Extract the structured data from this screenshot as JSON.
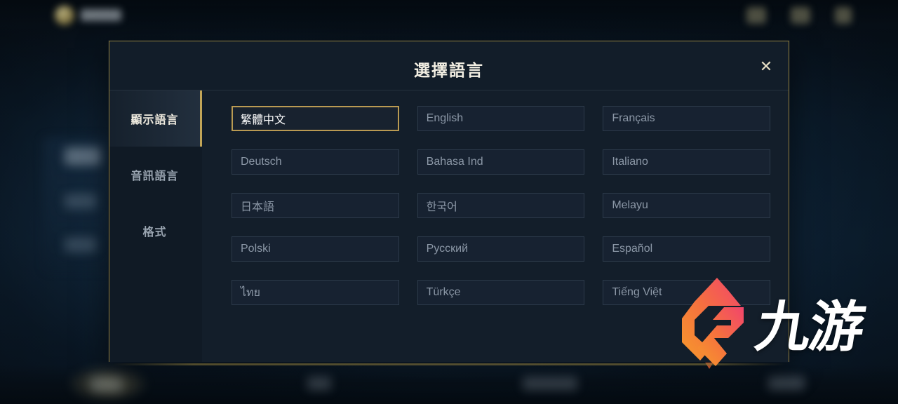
{
  "modal": {
    "title": "選擇語言",
    "close_label": "✕",
    "close_icon": "close-icon"
  },
  "sidebar": {
    "tabs": [
      {
        "label": "顯示語言",
        "active": true
      },
      {
        "label": "音訊語言",
        "active": false
      },
      {
        "label": "格式",
        "active": false
      }
    ]
  },
  "languages": [
    {
      "label": "繁體中文",
      "selected": true
    },
    {
      "label": "English",
      "selected": false
    },
    {
      "label": "Français",
      "selected": false
    },
    {
      "label": "Deutsch",
      "selected": false
    },
    {
      "label": "Bahasa Ind",
      "selected": false
    },
    {
      "label": "Italiano",
      "selected": false
    },
    {
      "label": "日本語",
      "selected": false
    },
    {
      "label": "한국어",
      "selected": false
    },
    {
      "label": "Melayu",
      "selected": false
    },
    {
      "label": "Polski",
      "selected": false
    },
    {
      "label": "Русский",
      "selected": false
    },
    {
      "label": "Español",
      "selected": false
    },
    {
      "label": "ไทย",
      "selected": false
    },
    {
      "label": "Türkçe",
      "selected": false
    },
    {
      "label": "Tiếng Việt",
      "selected": false
    }
  ],
  "watermark": {
    "text": "九游",
    "gradient_start": "#f7b733",
    "gradient_end": "#f2456c"
  },
  "colors": {
    "modal_border": "#8e7c3c",
    "accent_gold": "#c2a557",
    "selected_border": "#b99a52",
    "modal_bg": "#121d29",
    "sidebar_bg": "#101a25",
    "button_bg": "#172231",
    "button_text": "#8c98a7",
    "title_text": "#f3efe3"
  }
}
